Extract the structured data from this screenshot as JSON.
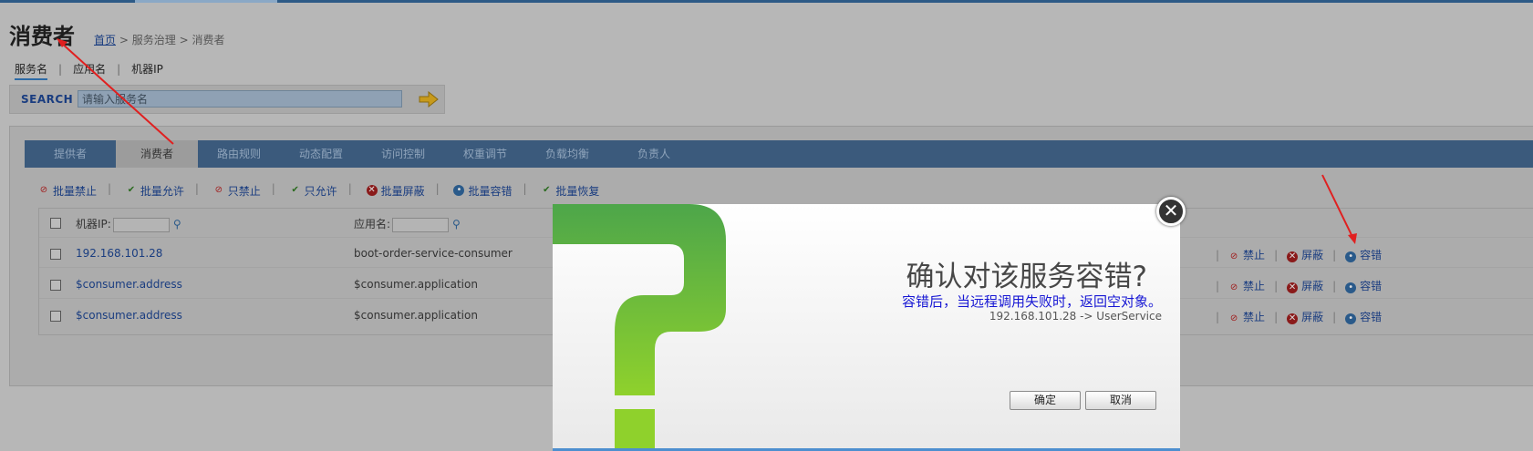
{
  "header": {
    "title": "消费者",
    "breadcrumb": {
      "home": "首页",
      "sep": ">",
      "level2": "服务治理",
      "level3": "消费者"
    }
  },
  "subtabs": [
    "服务名",
    "应用名",
    "机器IP"
  ],
  "search": {
    "label": "SEARCH",
    "placeholder": "请输入服务名"
  },
  "nav_tabs": [
    "提供者",
    "消费者",
    "路由规则",
    "动态配置",
    "访问控制",
    "权重调节",
    "负载均衡",
    "负责人"
  ],
  "batch_actions": [
    {
      "icon": "ban-icon",
      "label": "批量禁止"
    },
    {
      "icon": "check-icon",
      "label": "批量允许"
    },
    {
      "icon": "ban-icon",
      "label": "只禁止"
    },
    {
      "icon": "check-icon",
      "label": "只允许"
    },
    {
      "icon": "shield-icon",
      "label": "批量屏蔽"
    },
    {
      "icon": "tolerance-icon",
      "label": "批量容错"
    },
    {
      "icon": "check-icon",
      "label": "批量恢复"
    }
  ],
  "table": {
    "filters": {
      "ip_label": "机器IP:",
      "app_label": "应用名:"
    },
    "rows": [
      {
        "ip": "192.168.101.28",
        "app": "boot-order-service-consumer"
      },
      {
        "ip": "$consumer.address",
        "app": "$consumer.application"
      },
      {
        "ip": "$consumer.address",
        "app": "$consumer.application"
      }
    ],
    "row_actions": [
      "禁止",
      "屏蔽",
      "容错"
    ]
  },
  "dialog": {
    "title": "确认对该服务容错?",
    "message": "容错后，当远程调用失败时，返回空对象。",
    "detail": "192.168.101.28 -> UserService",
    "confirm": "确定",
    "cancel": "取消",
    "close": "✕"
  },
  "colors": {
    "overlay": "#b7b7b7",
    "nav": "#3b5a7c",
    "link": "#1a3d80",
    "dialog_text_blue": "#1717d4",
    "question_green": "#7dc63c",
    "annotation_red": "#e02020"
  }
}
